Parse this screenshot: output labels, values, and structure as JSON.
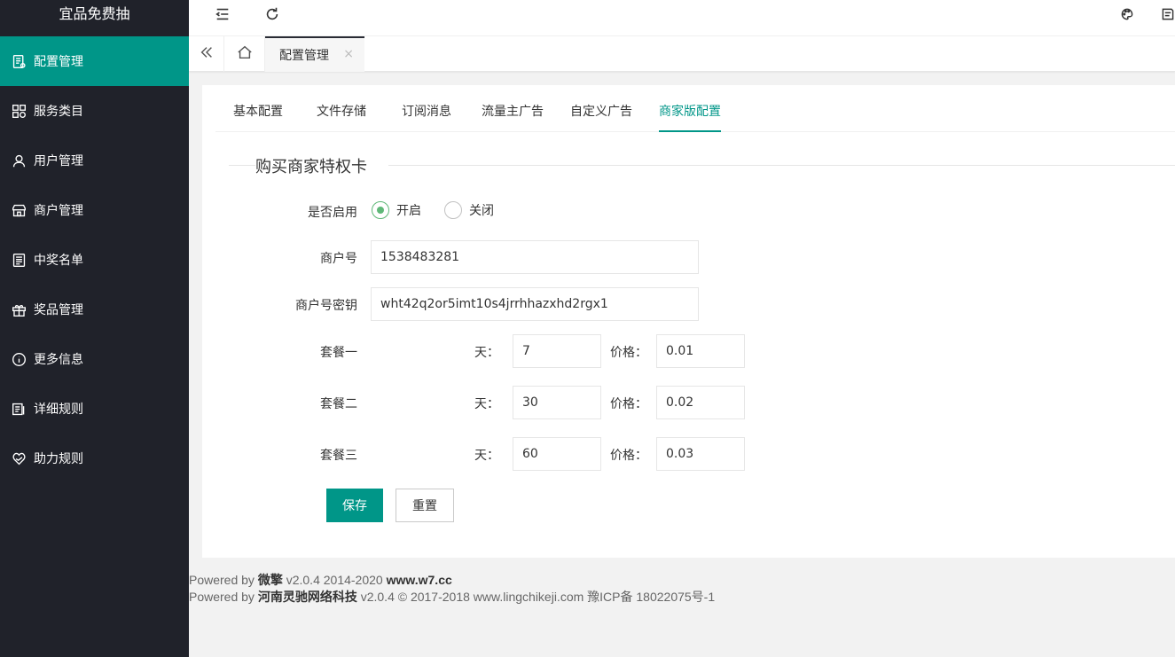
{
  "app": {
    "logo_title": "宜品免费抽"
  },
  "sidebar": {
    "items": [
      {
        "label": "配置管理",
        "icon": "config-doc-icon",
        "active": true
      },
      {
        "label": "服务类目",
        "icon": "grid-apps-icon"
      },
      {
        "label": "用户管理",
        "icon": "user-icon"
      },
      {
        "label": "商户管理",
        "icon": "store-icon"
      },
      {
        "label": "中奖名单",
        "icon": "list-doc-icon"
      },
      {
        "label": "奖品管理",
        "icon": "gift-icon"
      },
      {
        "label": "更多信息",
        "icon": "info-icon"
      },
      {
        "label": "详细规则",
        "icon": "rules-icon"
      },
      {
        "label": "助力规则",
        "icon": "heart-hands-icon"
      }
    ]
  },
  "header": {
    "menu_toggle_icon": "menu-fold-icon",
    "refresh_icon": "refresh-icon",
    "theme_icon": "palette-icon",
    "note_icon": "note-icon"
  },
  "tabbar": {
    "active_tab": "配置管理",
    "close_glyph": "×"
  },
  "subtabs": [
    "基本配置",
    "文件存储",
    "订阅消息",
    "流量主广告",
    "自定义广告",
    "商家版配置"
  ],
  "section": {
    "title": "购买商家特权卡"
  },
  "form": {
    "enable_label": "是否启用",
    "enable_on": "开启",
    "enable_off": "关闭",
    "enabled": true,
    "merchant_id_label": "商户号",
    "merchant_id_value": "1538483281",
    "merchant_key_label": "商户号密钥",
    "merchant_key_value": "wht42q2or5imt10s4jrrhhazxhd2rgx1",
    "days_label": "天：",
    "price_label": "价格：",
    "packages": [
      {
        "name": "套餐一",
        "days": "7",
        "price": "0.01"
      },
      {
        "name": "套餐二",
        "days": "30",
        "price": "0.02"
      },
      {
        "name": "套餐三",
        "days": "60",
        "price": "0.03"
      }
    ],
    "save_label": "保存",
    "reset_label": "重置"
  },
  "footer": {
    "line1_prefix": "Powered by",
    "line1_brand": "微擎",
    "line1_version": "v2.0.4 2014-2020",
    "line1_site": "www.w7.cc",
    "line2_prefix": "Powered by",
    "line2_brand": "河南灵驰网络科技",
    "line2_rest": "v2.0.4 © 2017-2018 www.lingchikeji.com 豫ICP备 18022075号-1"
  },
  "colors": {
    "primary": "#009688",
    "sidebar_bg": "#20222a",
    "radio_on": "#5fb878"
  }
}
